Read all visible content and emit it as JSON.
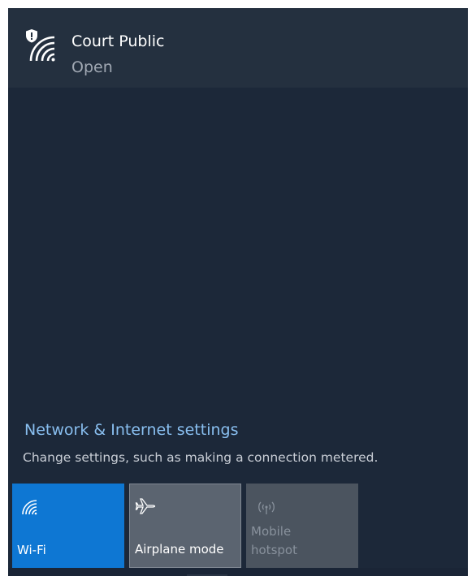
{
  "network": {
    "name": "Court Public",
    "status": "Open",
    "icon": "wifi-shield-icon"
  },
  "settings": {
    "title": "Network & Internet settings",
    "description": "Change settings, such as making a connection metered."
  },
  "quick_actions": [
    {
      "label": "Wi-Fi",
      "icon": "wifi-icon",
      "state": "on"
    },
    {
      "label": "Airplane mode",
      "icon": "airplane-icon",
      "state": "off"
    },
    {
      "label_line1": "Mobile",
      "label_line2": "hotspot",
      "icon": "hotspot-icon",
      "state": "disabled"
    }
  ],
  "colors": {
    "accent": "#0e77d3",
    "link": "#89bff0",
    "panel": "#1c2839"
  }
}
